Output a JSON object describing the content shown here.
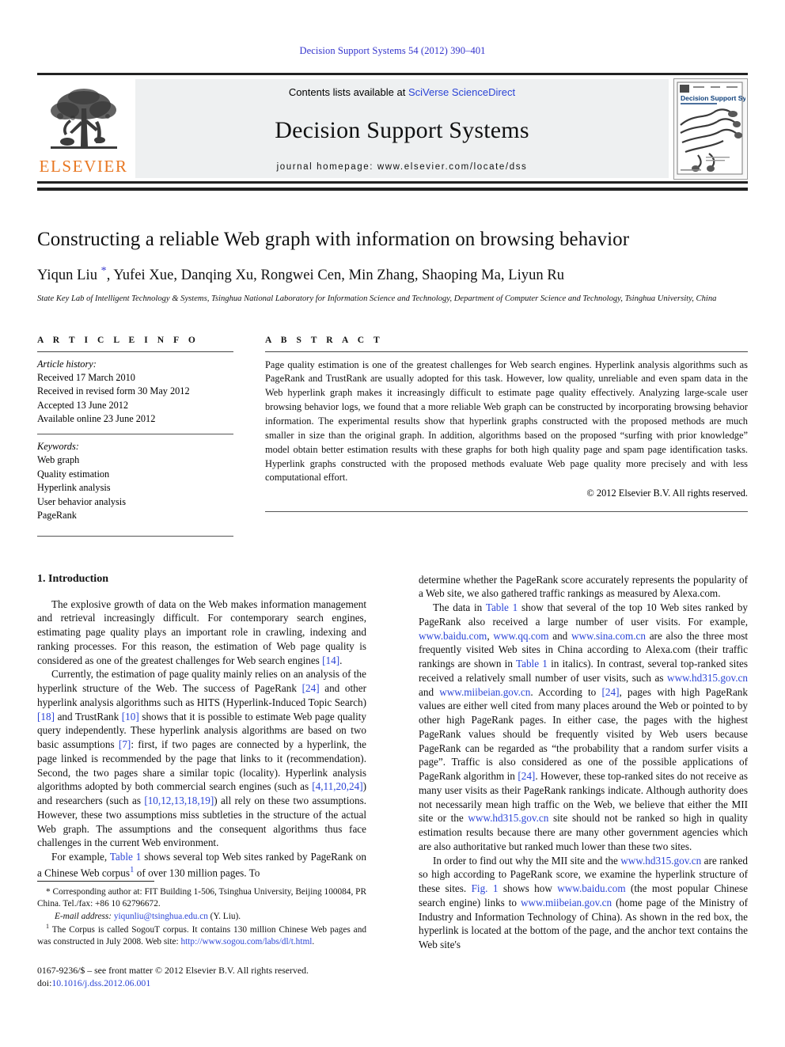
{
  "running_head": "Decision Support Systems 54 (2012) 390–401",
  "masthead": {
    "publisher_wordmark": "ELSEVIER",
    "contents_prefix": "Contents lists available at ",
    "contents_link": "SciVerse ScienceDirect",
    "journal_title": "Decision Support Systems",
    "homepage_line": "journal homepage: www.elsevier.com/locate/dss",
    "cover_title": "Decision Support Systems",
    "link_color": "#2b44d6",
    "brand_color": "#E87722"
  },
  "title_block": {
    "title": "Constructing a reliable Web graph with information on browsing behavior",
    "authors_before_star": "Yiqun Liu ",
    "corresponding_marker": "*",
    "authors_after_star": ", Yufei Xue, Danqing Xu, Rongwei Cen, Min Zhang, Shaoping Ma, Liyun Ru",
    "affiliation": "State Key Lab of Intelligent Technology & Systems, Tsinghua National Laboratory for Information Science and Technology, Department of Computer Science and Technology, Tsinghua University, China"
  },
  "article_info": {
    "heading": "A R T I C L E   I N F O",
    "history_label": "Article history:",
    "history": [
      "Received 17 March 2010",
      "Received in revised form 30 May 2012",
      "Accepted 13 June 2012",
      "Available online 23 June 2012"
    ],
    "keywords_label": "Keywords:",
    "keywords": [
      "Web graph",
      "Quality estimation",
      "Hyperlink analysis",
      "User behavior analysis",
      "PageRank"
    ]
  },
  "abstract": {
    "heading": "A B S T R A C T",
    "text": "Page quality estimation is one of the greatest challenges for Web search engines. Hyperlink analysis algorithms such as PageRank and TrustRank are usually adopted for this task. However, low quality, unreliable and even spam data in the Web hyperlink graph makes it increasingly difficult to estimate page quality effectively. Analyzing large-scale user browsing behavior logs, we found that a more reliable Web graph can be constructed by incorporating browsing behavior information. The experimental results show that hyperlink graphs constructed with the proposed methods are much smaller in size than the original graph. In addition, algorithms based on the proposed “surfing with prior knowledge” model obtain better estimation results with these graphs for both high quality page and spam page identification tasks. Hyperlink graphs constructed with the proposed methods evaluate Web page quality more precisely and with less computational effort.",
    "copyright": "© 2012 Elsevier B.V. All rights reserved."
  },
  "body": {
    "section_number_title": "1. Introduction",
    "left_paragraphs": [
      {
        "runs": [
          {
            "t": "The explosive growth of data on the Web makes information management and retrieval increasingly difficult. For contemporary search engines, estimating page quality plays an important role in crawling, indexing and ranking processes. For this reason, the estimation of Web page quality is considered as one of the greatest challenges for Web search engines "
          },
          {
            "t": "[14]",
            "link": true
          },
          {
            "t": "."
          }
        ]
      },
      {
        "runs": [
          {
            "t": "Currently, the estimation of page quality mainly relies on an analysis of the hyperlink structure of the Web. The success of PageRank "
          },
          {
            "t": "[24]",
            "link": true
          },
          {
            "t": " and other hyperlink analysis algorithms such as HITS (Hyperlink-Induced Topic Search) "
          },
          {
            "t": "[18]",
            "link": true
          },
          {
            "t": " and TrustRank "
          },
          {
            "t": "[10]",
            "link": true
          },
          {
            "t": " shows that it is possible to estimate Web page quality query independently. These hyperlink analysis algorithms are based on two basic assumptions "
          },
          {
            "t": "[7]",
            "link": true
          },
          {
            "t": ": first, if two pages are connected by a hyperlink, the page linked is recommended by the page that links to it (recommendation). Second, the two pages share a similar topic (locality). Hyperlink analysis algorithms adopted by both commercial search engines (such as "
          },
          {
            "t": "[4,11,20,24]",
            "link": true
          },
          {
            "t": ") and researchers (such as "
          },
          {
            "t": "[10,12,13,18,19]",
            "link": true
          },
          {
            "t": ") all rely on these two assumptions. However, these two assumptions miss subtleties in the structure of the actual Web graph. The assumptions and the consequent algorithms thus face challenges in the current Web environment."
          }
        ]
      },
      {
        "runs": [
          {
            "t": "For example, "
          },
          {
            "t": "Table 1",
            "link": true
          },
          {
            "t": " shows several top Web sites ranked by PageRank on a Chinese Web corpus"
          },
          {
            "t": "1",
            "sup": true,
            "link": true
          },
          {
            "t": " of over 130 million pages. To"
          }
        ]
      }
    ],
    "right_paragraphs": [
      {
        "runs": [
          {
            "t": "determine whether the PageRank score accurately represents the popularity of a Web site, we also gathered traffic rankings as measured by Alexa.com."
          }
        ],
        "noindent": true
      },
      {
        "runs": [
          {
            "t": "The data in "
          },
          {
            "t": "Table 1",
            "link": true
          },
          {
            "t": " show that several of the top 10 Web sites ranked by PageRank also received a large number of user visits. For example, "
          },
          {
            "t": "www.baidu.com",
            "link": true
          },
          {
            "t": ", "
          },
          {
            "t": "www.qq.com",
            "link": true
          },
          {
            "t": " and "
          },
          {
            "t": "www.sina.com.cn",
            "link": true
          },
          {
            "t": " are also the three most frequently visited Web sites in China according to Alexa.com (their traffic rankings are shown in "
          },
          {
            "t": "Table 1",
            "link": true
          },
          {
            "t": " in italics). In contrast, several top-ranked sites received a relatively small number of user visits, such as "
          },
          {
            "t": "www.hd315.gov.cn",
            "link": true
          },
          {
            "t": " and "
          },
          {
            "t": "www.miibeian.gov.cn",
            "link": true
          },
          {
            "t": ". According to "
          },
          {
            "t": "[24]",
            "link": true
          },
          {
            "t": ", pages with high PageRank values are either well cited from many places around the Web or pointed to by other high PageRank pages. In either case, the pages with the highest PageRank values should be frequently visited by Web users because PageRank can be regarded as “the probability that a random surfer visits a page”. Traffic is also considered as one of the possible applications of PageRank algorithm in "
          },
          {
            "t": "[24]",
            "link": true
          },
          {
            "t": ". However, these top-ranked sites do not receive as many user visits as their PageRank rankings indicate. Although authority does not necessarily mean high traffic on the Web, we believe that either the MII site or the "
          },
          {
            "t": "www.hd315.gov.cn",
            "link": true
          },
          {
            "t": " site should not be ranked so high in quality estimation results because there are many other government agencies which are also authoritative but ranked much lower than these two sites."
          }
        ]
      },
      {
        "runs": [
          {
            "t": "In order to find out why the MII site and the "
          },
          {
            "t": "www.hd315.gov.cn",
            "link": true
          },
          {
            "t": " are ranked so high according to PageRank score, we examine the hyperlink structure of these sites. "
          },
          {
            "t": "Fig. 1",
            "link": true
          },
          {
            "t": " shows how "
          },
          {
            "t": "www.baidu.com",
            "link": true
          },
          {
            "t": " (the most popular Chinese search engine) links to "
          },
          {
            "t": "www.miibeian.gov.cn",
            "link": true
          },
          {
            "t": " (home page of the Ministry of Industry and Information Technology of China). As shown in the red box, the hyperlink is located at the bottom of the page, and the anchor text contains the Web site's"
          }
        ]
      }
    ]
  },
  "footnotes": {
    "corresponding": {
      "marker": "*",
      "text": " Corresponding author at: FIT Building 1-506, Tsinghua University, Beijing 100084, PR China. Tel./fax: +86 10 62796672."
    },
    "email": {
      "label": "E-mail address:",
      "address": "yiqunliu@tsinghua.edu.cn",
      "suffix": " (Y. Liu)."
    },
    "corpus": {
      "marker": "1",
      "text_before_link": " The Corpus is called SogouT corpus. It contains 130 million Chinese Web pages and was constructed in July 2008. Web site: ",
      "link": "http://www.sogou.com/labs/dl/t.html",
      "text_after_link": "."
    },
    "imprint_line": "0167-9236/$ – see front matter © 2012 Elsevier B.V. All rights reserved.",
    "doi_label": "doi:",
    "doi_value": "10.1016/j.dss.2012.06.001"
  }
}
